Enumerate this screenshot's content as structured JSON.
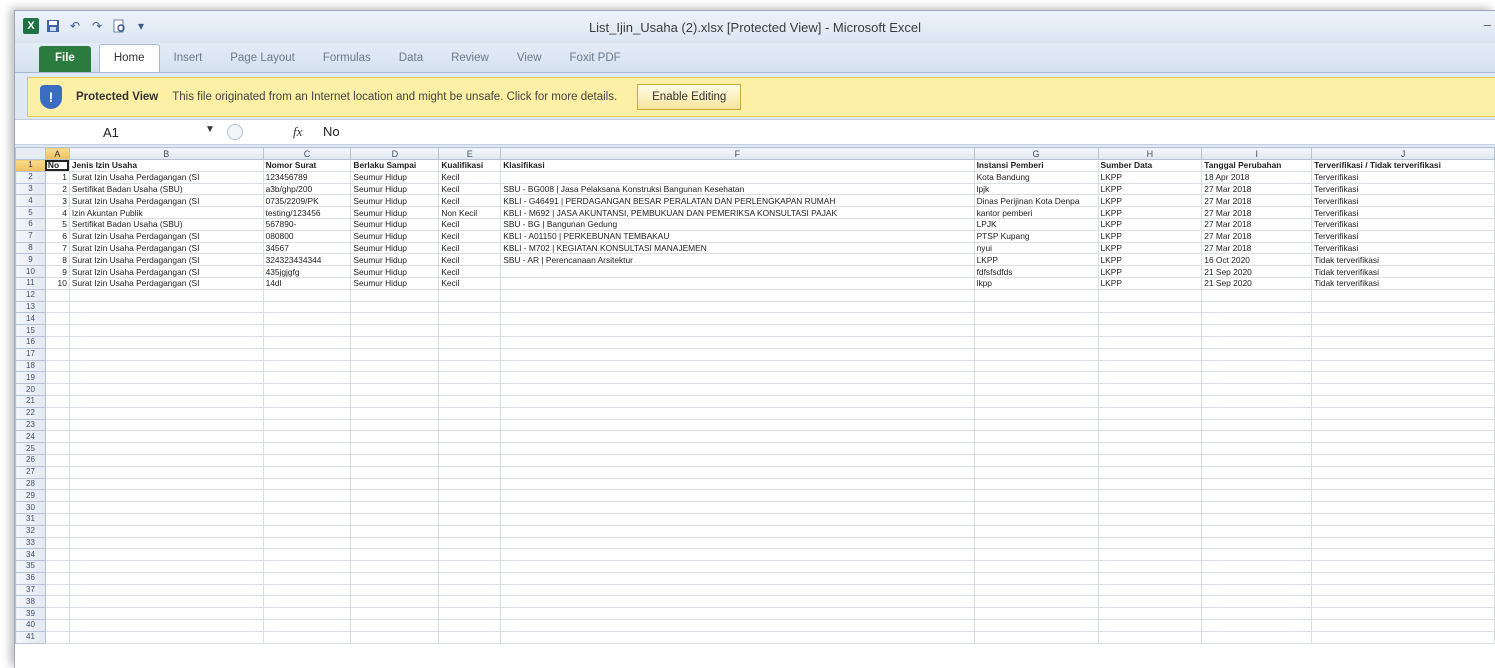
{
  "window": {
    "title": "List_Ijin_Usaha (2).xlsx  [Protected View]  -  Microsoft Excel",
    "minimize": "–"
  },
  "quick_access": {
    "app_icon": "X",
    "save_icon": "save-icon",
    "undo_icon": "undo-icon",
    "redo_icon": "redo-icon",
    "preview_icon": "print-preview-icon",
    "customize": "▾"
  },
  "ribbon": {
    "tabs": [
      "File",
      "Home",
      "Insert",
      "Page Layout",
      "Formulas",
      "Data",
      "Review",
      "View",
      "Foxit PDF"
    ]
  },
  "protected_view": {
    "title": "Protected View",
    "message": "This file originated from an Internet location and might be unsafe. Click for more details.",
    "button": "Enable Editing",
    "icon": "shield-icon"
  },
  "formula_bar": {
    "name_box": "A1",
    "fx_label": "fx",
    "value": "No"
  },
  "sheet": {
    "columns": [
      "A",
      "B",
      "C",
      "D",
      "E",
      "F",
      "G",
      "H",
      "I",
      "J"
    ],
    "header_row": [
      "No",
      "Jenis Izin Usaha",
      "Nomor Surat",
      "Berlaku Sampai",
      "Kualifikasi",
      "Klasifikasi",
      "Instansi Pemberi",
      "Sumber Data",
      "Tanggal Perubahan",
      "Terverifikasi / Tidak terverifikasi"
    ],
    "rows": [
      [
        "1",
        "Surat Izin Usaha Perdagangan (SI",
        "123456789",
        "Seumur Hidup",
        "Kecil",
        "",
        "Kota Bandung",
        "LKPP",
        "18 Apr 2018",
        "Terverifikasi"
      ],
      [
        "2",
        "Sertifikat Badan Usaha (SBU)",
        "a3b/ghp/200",
        "Seumur Hidup",
        "Kecil",
        "SBU - BG008 | Jasa Pelaksana Konstruksi Bangunan Kesehatan",
        "lpjk",
        "LKPP",
        "27 Mar 2018",
        "Terverifikasi"
      ],
      [
        "3",
        "Surat Izin Usaha Perdagangan (SI",
        "0735/2209/PK",
        "Seumur Hidup",
        "Kecil",
        "KBLI - G46491 | PERDAGANGAN BESAR PERALATAN DAN PERLENGKAPAN RUMAH",
        "Dinas Perijinan Kota Denpa",
        "LKPP",
        "27 Mar 2018",
        "Terverifikasi"
      ],
      [
        "4",
        "Izin Akuntan Publik",
        "testing/123456",
        "Seumur Hidup",
        "Non Kecil",
        "KBLI - M692 | JASA AKUNTANSI, PEMBUKUAN DAN PEMERIKSA KONSULTASI PAJAK",
        "kantor pemberi",
        "LKPP",
        "27 Mar 2018",
        "Terverifikasi"
      ],
      [
        "5",
        "Sertifikat Badan Usaha (SBU)",
        "567890-",
        "Seumur Hidup",
        "Kecil",
        "SBU - BG | Bangunan Gedung",
        "LPJK",
        "LKPP",
        "27 Mar 2018",
        "Terverifikasi"
      ],
      [
        "6",
        "Surat Izin Usaha Perdagangan (SI",
        "080800",
        "Seumur Hidup",
        "Kecil",
        "KBLI - A01150 | PERKEBUNAN TEMBAKAU",
        "PTSP Kupang",
        "LKPP",
        "27 Mar 2018",
        "Terverifikasi"
      ],
      [
        "7",
        "Surat Izin Usaha Perdagangan (SI",
        "34567",
        "Seumur Hidup",
        "Kecil",
        "KBLI - M702 | KEGIATAN KONSULTASI MANAJEMEN",
        "nyui",
        "LKPP",
        "27 Mar 2018",
        "Terverifikasi"
      ],
      [
        "8",
        "Surat Izin Usaha Perdagangan (SI",
        "324323434344",
        "Seumur Hidup",
        "Kecil",
        "SBU - AR | Perencanaan Arsitektur",
        "LKPP",
        "LKPP",
        "16 Oct 2020",
        "Tidak terverifikasi"
      ],
      [
        "9",
        "Surat Izin Usaha Perdagangan (SI",
        "435jgjgfg",
        "Seumur Hidup",
        "Kecil",
        "",
        "fdfsfsdfds",
        "LKPP",
        "21 Sep 2020",
        "Tidak terverifikasi"
      ],
      [
        "10",
        "Surat Izin Usaha Perdagangan (SI",
        "14dl",
        "Seumur Hidup",
        "Kecil",
        "",
        "lkpp",
        "LKPP",
        "21 Sep 2020",
        "Tidak terverifikasi"
      ]
    ],
    "row_numbers": [
      "1",
      "2",
      "3",
      "4",
      "5",
      "6",
      "7",
      "8",
      "9",
      "10",
      "11",
      "12",
      "13",
      "14",
      "15",
      "16",
      "17",
      "18",
      "19",
      "20",
      "21",
      "22",
      "23",
      "24",
      "25",
      "26",
      "27",
      "28",
      "29",
      "30",
      "31",
      "32",
      "33",
      "34",
      "35",
      "36",
      "37",
      "38",
      "39",
      "40",
      "41"
    ]
  }
}
